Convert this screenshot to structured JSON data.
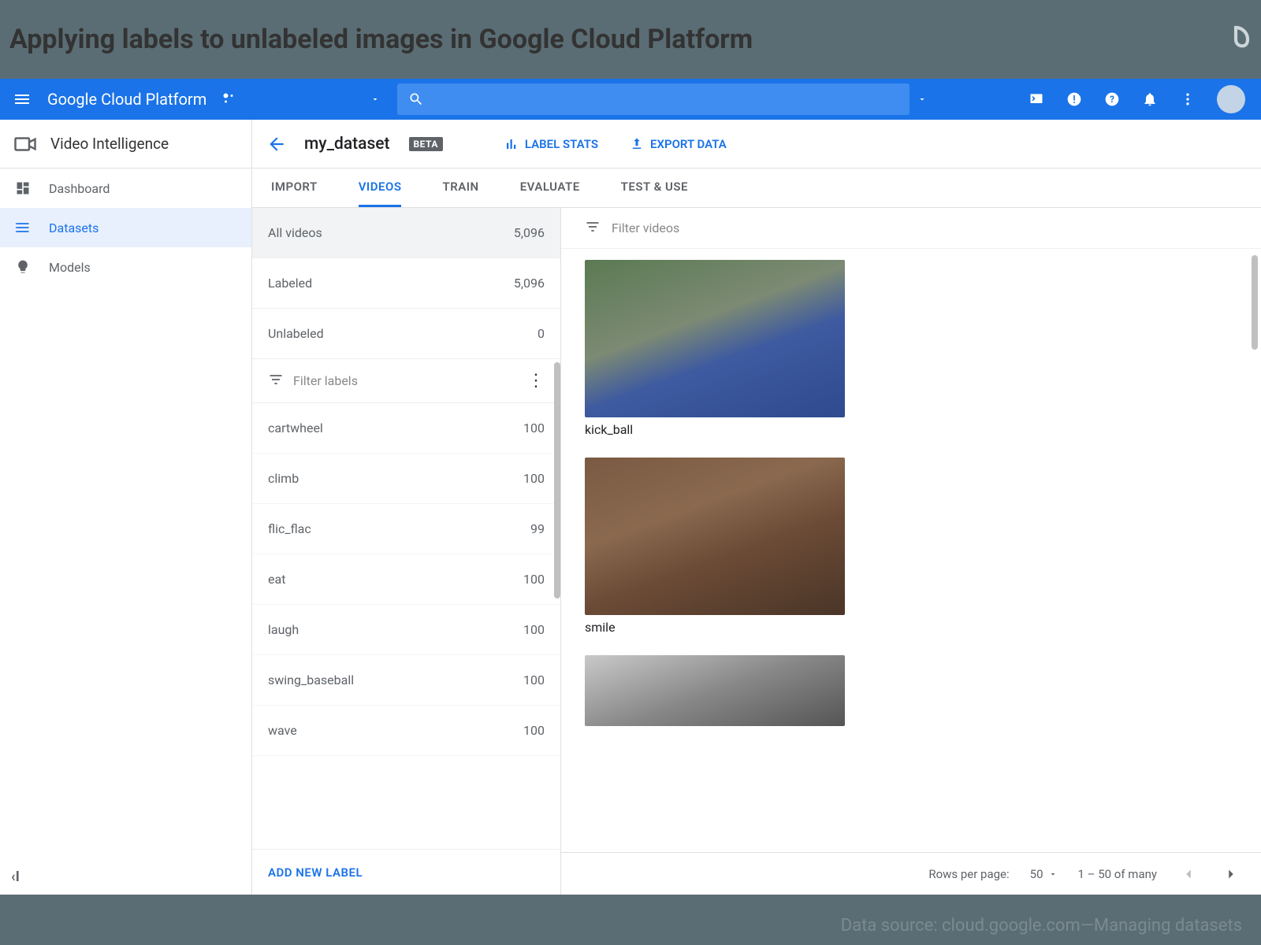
{
  "titlebar": {
    "heading": "Applying labels to unlabeled images in Google Cloud Platform"
  },
  "header": {
    "brand": "Google Cloud Platform"
  },
  "sidebar": {
    "product": "Video Intelligence",
    "items": [
      {
        "label": "Dashboard"
      },
      {
        "label": "Datasets"
      },
      {
        "label": "Models"
      }
    ]
  },
  "dataset": {
    "name": "my_dataset",
    "badge": "BETA",
    "actions": {
      "stats": "LABEL STATS",
      "export": "EXPORT DATA"
    },
    "tabs": [
      "IMPORT",
      "VIDEOS",
      "TRAIN",
      "EVALUATE",
      "TEST & USE"
    ]
  },
  "label_panel": {
    "stats": [
      {
        "label": "All videos",
        "count": "5,096"
      },
      {
        "label": "Labeled",
        "count": "5,096"
      },
      {
        "label": "Unlabeled",
        "count": "0"
      }
    ],
    "filter_placeholder": "Filter labels",
    "labels": [
      {
        "name": "cartwheel",
        "count": "100"
      },
      {
        "name": "climb",
        "count": "100"
      },
      {
        "name": "flic_flac",
        "count": "99"
      },
      {
        "name": "eat",
        "count": "100"
      },
      {
        "name": "laugh",
        "count": "100"
      },
      {
        "name": "swing_baseball",
        "count": "100"
      },
      {
        "name": "wave",
        "count": "100"
      }
    ],
    "add_new": "ADD NEW LABEL"
  },
  "videos_panel": {
    "filter_placeholder": "Filter videos",
    "thumbs": [
      {
        "caption": "kick_ball"
      },
      {
        "caption": "smile"
      }
    ],
    "pager": {
      "rows_label": "Rows per page:",
      "rows_value": "50",
      "range": "1 – 50 of many"
    }
  },
  "footer": {
    "caption": "Data source: cloud.google.com—Managing datasets"
  }
}
